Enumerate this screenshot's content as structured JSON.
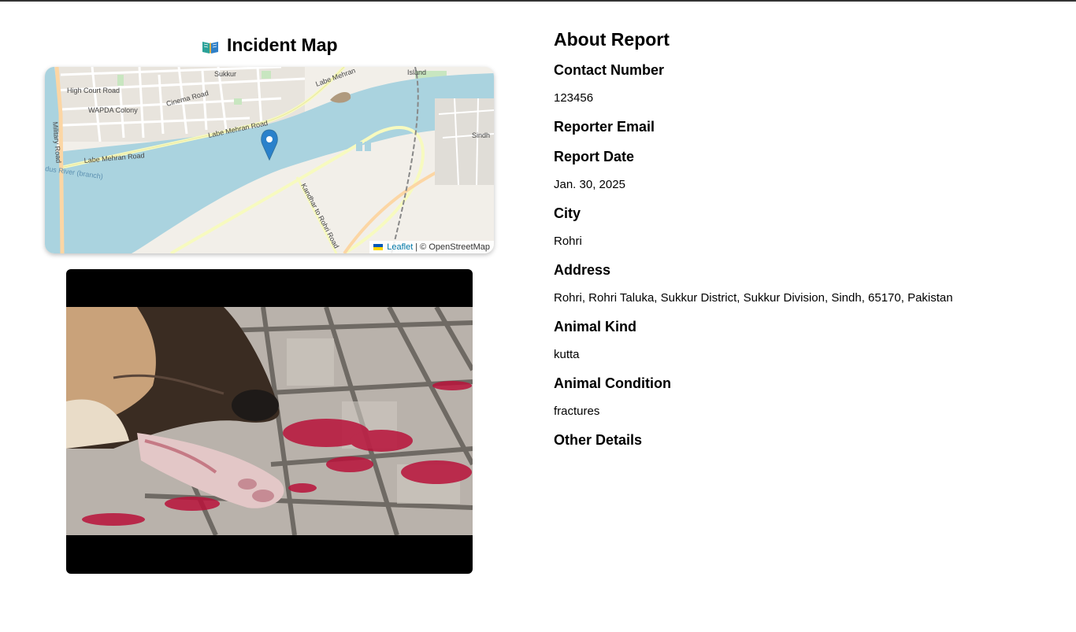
{
  "map": {
    "title": "Incident Map",
    "attribution_leaflet": "Leaflet",
    "attribution_rest": "| © OpenStreetMap",
    "labels": {
      "high_court_road": "High Court Road",
      "wapda_colony": "WAPDA Colony",
      "cinema_road": "Cinema Road",
      "labe_mehran_road_1": "Labe Mehran Road",
      "labe_mehran_road_2": "Labe Mehran Road",
      "labe_mehran_road_3": "Labe Mehran",
      "military_road": "Military Road",
      "indus_river_branch": "dus River (branch)",
      "kandhar_rohri_road": "Kandhar to Rohri Road",
      "sukkur": "Sukkur",
      "island": "Island",
      "sindh": "Sindh"
    }
  },
  "report": {
    "heading": "About Report",
    "fields": [
      {
        "label": "Contact Number",
        "value": "123456"
      },
      {
        "label": "Reporter Email",
        "value": ""
      },
      {
        "label": "Report Date",
        "value": "Jan. 30, 2025"
      },
      {
        "label": "City",
        "value": "Rohri"
      },
      {
        "label": "Address",
        "value": "Rohri, Rohri Taluka, Sukkur District, Sukkur Division, Sindh, 65170, Pakistan"
      },
      {
        "label": "Animal Kind",
        "value": "kutta"
      },
      {
        "label": "Animal Condition",
        "value": "fractures"
      },
      {
        "label": "Other Details",
        "value": ""
      }
    ]
  },
  "colors": {
    "river": "#aad3df",
    "land": "#f2efe9",
    "marker": "#2a81cb",
    "road_major": "#f7fabf",
    "road_primary": "#fcd6a4"
  },
  "icons": {
    "map_title": "open-book-icon",
    "marker": "map-pin-icon"
  }
}
